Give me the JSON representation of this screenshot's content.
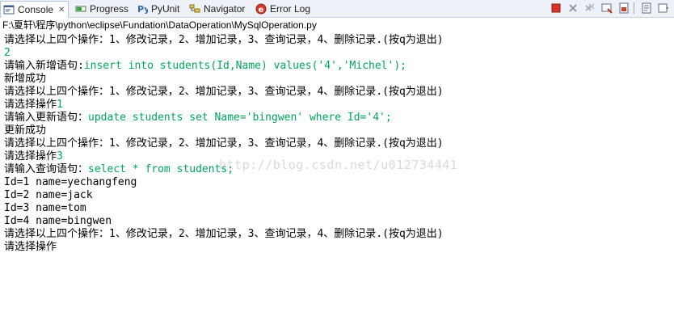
{
  "tabs": [
    {
      "label": "Console",
      "icon": "console-icon",
      "active": true
    },
    {
      "label": "Progress",
      "icon": "progress-icon"
    },
    {
      "label": "PyUnit",
      "icon": "pyunit-icon"
    },
    {
      "label": "Navigator",
      "icon": "navigator-icon"
    },
    {
      "label": "Error Log",
      "icon": "error-log-icon"
    }
  ],
  "toolbar": {
    "icons": [
      "terminate-icon",
      "remove-launch-icon",
      "remove-all-icon",
      "clear-console-icon",
      "scroll-lock-icon",
      "show-console-icon",
      "display-selected-console-icon"
    ]
  },
  "path": "F:\\夏轩\\程序\\python\\eclipse\\Fundation\\DataOperation\\MySqlOperation.py",
  "console": {
    "l1": "请选择以上四个操作：1、修改记录，2、增加记录，3、查询记录，4、删除记录.(按q为退出)",
    "l2": "2",
    "l3a": "请输入新增语句:",
    "l3b": "insert into students(Id,Name) values('4','Michel');",
    "l4": "新增成功",
    "l5": "请选择以上四个操作：1、修改记录，2、增加记录，3、查询记录，4、删除记录.(按q为退出)",
    "l6a": "请选择操作",
    "l6b": "1",
    "l7a": "请输入更新语句：",
    "l7b": "update students set Name='bingwen' where Id='4';",
    "l8": "更新成功",
    "l9": "请选择以上四个操作：1、修改记录，2、增加记录，3、查询记录，4、删除记录.(按q为退出)",
    "l10a": "请选择操作",
    "l10b": "3",
    "l11a": "请输入查询语句：",
    "l11b": "select * from students;",
    "l12": "Id=1 name=yechangfeng",
    "l13": "Id=2 name=jack",
    "l14": "Id=3 name=tom",
    "l15": "Id=4 name=bingwen",
    "l16": "请选择以上四个操作：1、修改记录，2、增加记录，3、查询记录，4、删除记录.(按q为退出)",
    "l17": "请选择操作"
  },
  "watermark": "http://blog.csdn.net/u012734441",
  "colors": {
    "user_input": "#00a65a",
    "tab_bar": "#eef2f8"
  }
}
